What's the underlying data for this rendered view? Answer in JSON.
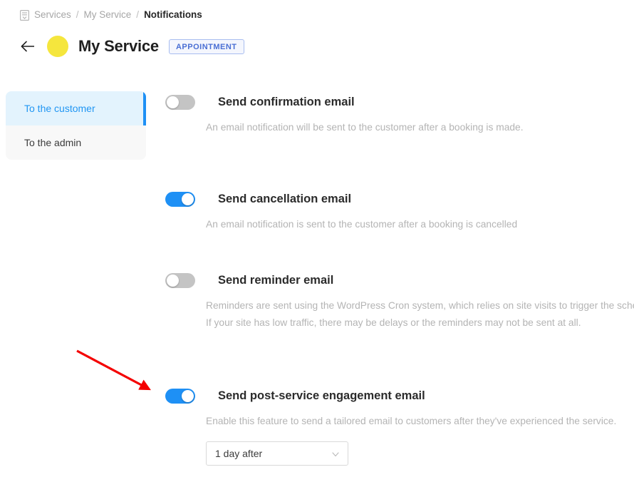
{
  "breadcrumb": {
    "icon": "document-list-icon",
    "items": [
      {
        "label": "Services",
        "current": false
      },
      {
        "label": "My Service",
        "current": false
      },
      {
        "label": "Notifications",
        "current": true
      }
    ],
    "separator": "/"
  },
  "header": {
    "back_icon": "arrow-left-icon",
    "avatar_color": "#f5e63d",
    "title": "My Service",
    "badge": "APPOINTMENT"
  },
  "sidebar": {
    "items": [
      {
        "label": "To the customer",
        "active": true
      },
      {
        "label": "To the admin",
        "active": false
      }
    ]
  },
  "colors": {
    "accent_blue": "#1e90f5",
    "active_tab_bg": "#e3f3fd",
    "toggle_off": "#c4c4c4",
    "annotation_red": "#f40000"
  },
  "settings": [
    {
      "id": "send-confirmation-email",
      "label": "Send confirmation email",
      "enabled": false,
      "description": "An email notification will be sent to the customer after a booking is made."
    },
    {
      "id": "send-cancellation-email",
      "label": "Send cancellation email",
      "enabled": true,
      "description": "An email notification is sent to the customer after a booking is cancelled"
    },
    {
      "id": "send-reminder-email",
      "label": "Send reminder email",
      "enabled": false,
      "description": "Reminders are sent using the WordPress Cron system, which relies on site visits to trigger the scheduled events. If your site has low traffic, there may be delays or the reminders may not be sent at all."
    },
    {
      "id": "send-post-service-engagement-email",
      "label": "Send post-service engagement email",
      "enabled": true,
      "description": "Enable this feature to send a tailored email to customers after they've experienced the service."
    }
  ],
  "timing_select": {
    "value": "1 day after",
    "caret_icon": "chevron-down-icon"
  },
  "annotation": {
    "type": "red-arrow",
    "points_to": "send-post-service-engagement-email-toggle"
  }
}
